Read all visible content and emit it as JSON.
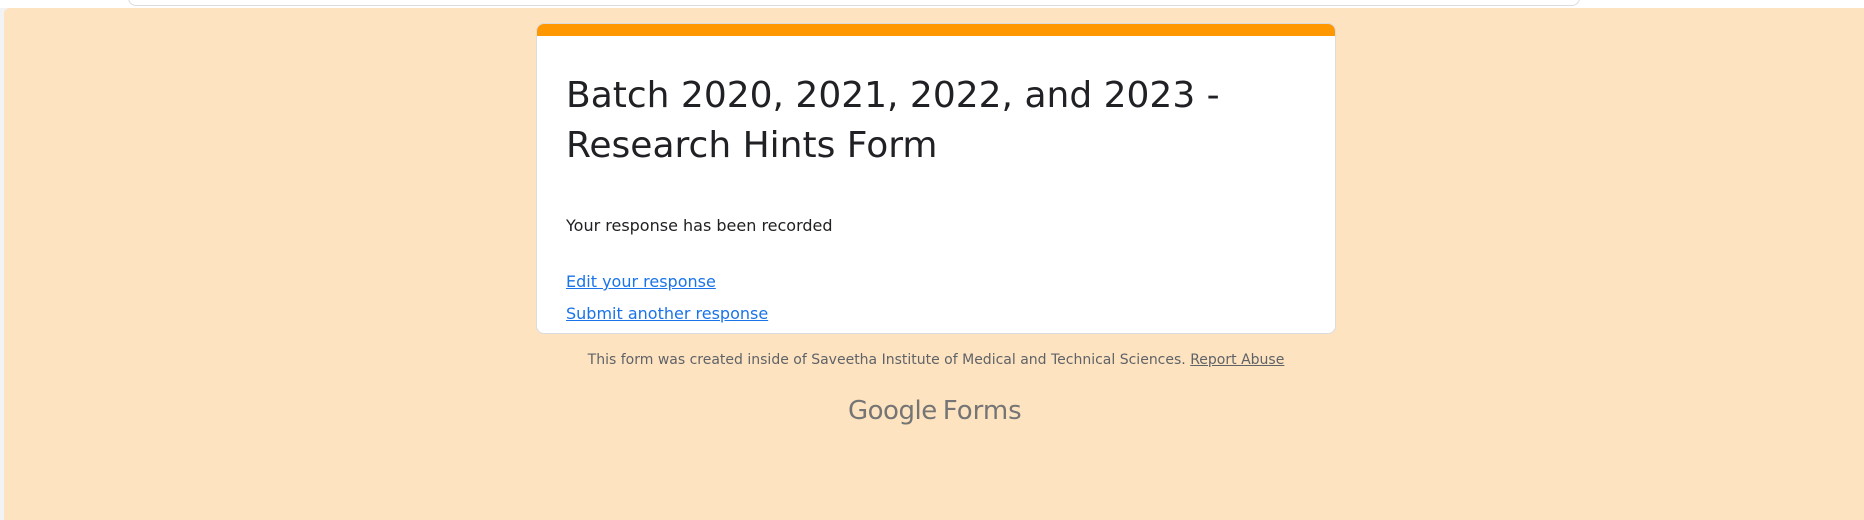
{
  "colors": {
    "background": "#fde3c0",
    "accent": "#ff9800",
    "link": "#1a73e8",
    "muted_text": "#5f6368",
    "title_text": "#202124"
  },
  "form": {
    "title": "Batch 2020, 2021, 2022, and 2023 - Research Hints Form",
    "confirmation_message": "Your response has been recorded",
    "edit_link_label": "Edit your response",
    "submit_another_link_label": "Submit another response"
  },
  "footer": {
    "note": "This form was created inside of Saveetha Institute of Medical and Technical Sciences.",
    "report_abuse_label": "Report Abuse"
  },
  "brand": {
    "google": "Google",
    "forms": "Forms"
  }
}
